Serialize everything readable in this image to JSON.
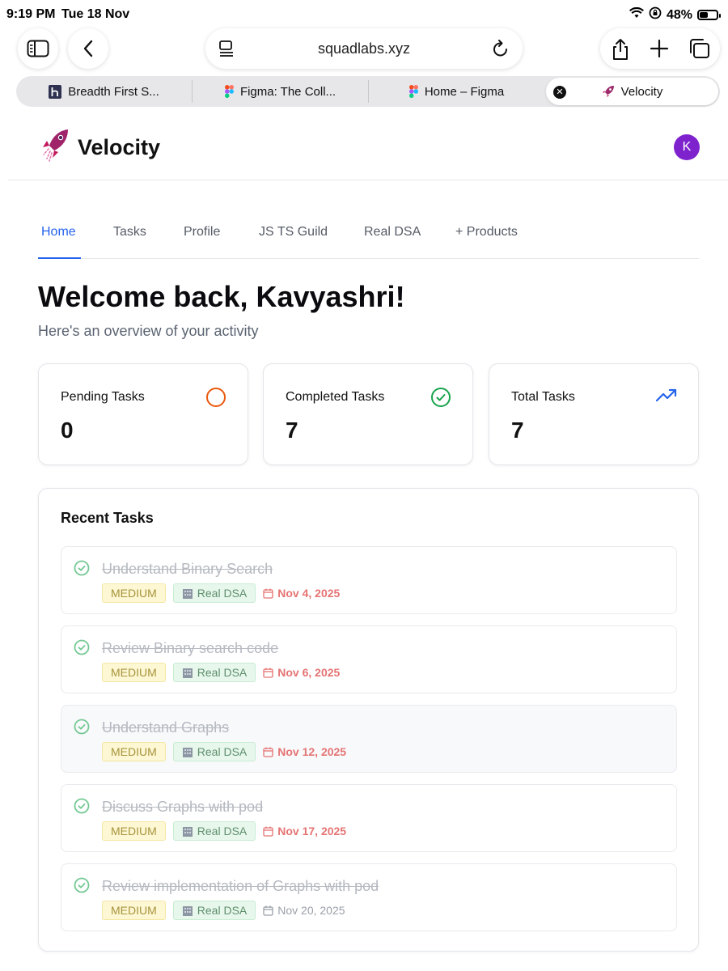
{
  "status_bar": {
    "time": "9:19 PM",
    "date": "Tue 18 Nov",
    "battery": "48%",
    "battery_level": 0.48
  },
  "browser": {
    "url": "squadlabs.xyz",
    "tabs": [
      {
        "label": "Breadth First S...",
        "icon": "h-logo-icon",
        "active": false
      },
      {
        "label": "Figma: The Coll...",
        "icon": "figma-icon",
        "active": false
      },
      {
        "label": "Home – Figma",
        "icon": "figma-icon",
        "active": false
      },
      {
        "label": "Velocity",
        "icon": "rocket-icon",
        "active": true
      }
    ]
  },
  "app": {
    "brand": "Velocity",
    "avatar_initial": "K",
    "colors": {
      "accent": "#2563eb",
      "avatar": "#7e22ce",
      "pending": "#ea580c",
      "completed": "#16a34a",
      "date_overdue": "#e57373"
    }
  },
  "nav": {
    "items": [
      {
        "label": "Home",
        "active": true
      },
      {
        "label": "Tasks",
        "active": false
      },
      {
        "label": "Profile",
        "active": false
      },
      {
        "label": "JS TS Guild",
        "active": false
      },
      {
        "label": "Real DSA",
        "active": false
      },
      {
        "label": "+ Products",
        "active": false
      }
    ]
  },
  "welcome": {
    "title": "Welcome back, Kavyashri!",
    "subtitle": "Here's an overview of your activity"
  },
  "stats": [
    {
      "label": "Pending Tasks",
      "value": "0",
      "icon": "pending-circle-icon"
    },
    {
      "label": "Completed Tasks",
      "value": "7",
      "icon": "check-circle-icon"
    },
    {
      "label": "Total Tasks",
      "value": "7",
      "icon": "trending-up-icon"
    }
  ],
  "recent": {
    "title": "Recent Tasks",
    "tasks": [
      {
        "title": "Understand Binary Search",
        "priority": "MEDIUM",
        "project": "Real DSA",
        "date": "Nov 4, 2025",
        "overdue": true
      },
      {
        "title": "Review Binary search code",
        "priority": "MEDIUM",
        "project": "Real DSA",
        "date": "Nov 6, 2025",
        "overdue": true
      },
      {
        "title": "Understand Graphs",
        "priority": "MEDIUM",
        "project": "Real DSA",
        "date": "Nov 12, 2025",
        "overdue": true
      },
      {
        "title": "Discuss Graphs with pod",
        "priority": "MEDIUM",
        "project": "Real DSA",
        "date": "Nov 17, 2025",
        "overdue": true
      },
      {
        "title": "Review implementation of Graphs with pod",
        "priority": "MEDIUM",
        "project": "Real DSA",
        "date": "Nov 20, 2025",
        "overdue": false
      }
    ]
  }
}
